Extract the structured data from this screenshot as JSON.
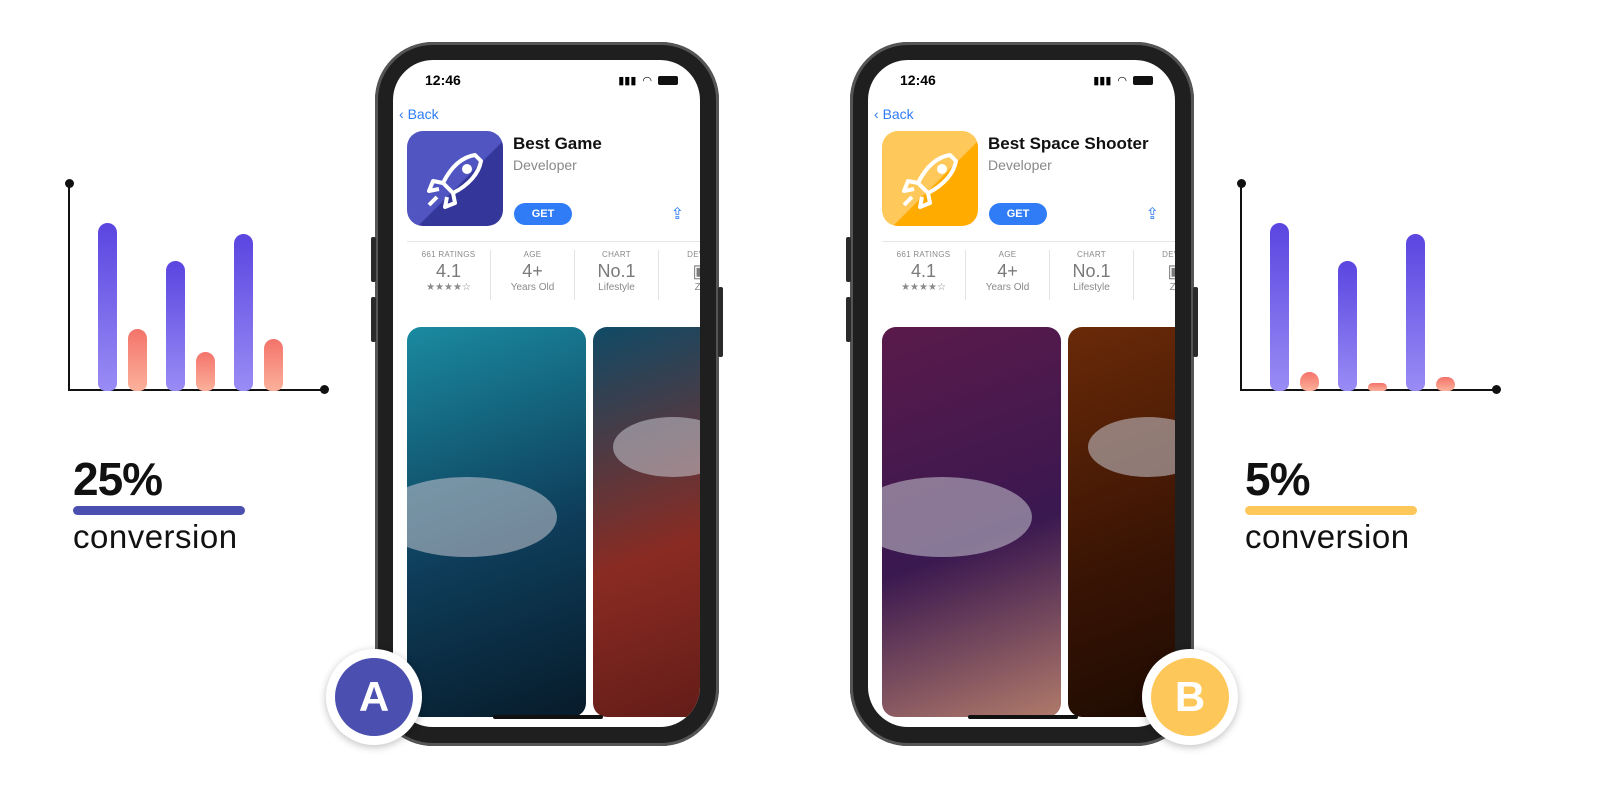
{
  "variants": [
    {
      "key": "a",
      "badge": "A",
      "accent": "#4b4fb0",
      "conversion_value": "25%",
      "conversion_label": "conversion",
      "chart_bars": [
        0.81,
        0.3,
        0.63,
        0.19,
        0.76,
        0.25
      ],
      "icon_colors": [
        "#5155c2",
        "#34369a"
      ],
      "app": {
        "time": "12:46",
        "back": "Back",
        "title": "Best Game",
        "developer": "Developer",
        "get": "GET",
        "stats": [
          {
            "h": "661 RATINGS",
            "v": "4.1",
            "s": "★★★★☆"
          },
          {
            "h": "AGE",
            "v": "4+",
            "s": "Years Old"
          },
          {
            "h": "CHART",
            "v": "No.1",
            "s": "Lifestyle"
          },
          {
            "h": "DEVEL",
            "v": "▣",
            "s": "ZA"
          }
        ]
      },
      "shots": [
        [
          "#1a8aa0",
          "#0e3d5a",
          "#071b2a"
        ],
        [
          "#0f4a66",
          "#8a2b22",
          "#5e1a17"
        ]
      ]
    },
    {
      "key": "b",
      "badge": "B",
      "accent": "#fdc75a",
      "conversion_value": "5%",
      "conversion_label": "conversion",
      "chart_bars": [
        0.81,
        0.09,
        0.63,
        0.04,
        0.76,
        0.07
      ],
      "icon_colors": [
        "#ffc85a",
        "#ffab00"
      ],
      "app": {
        "time": "12:46",
        "back": "Back",
        "title": "Best  Space Shooter",
        "developer": "Developer",
        "get": "GET",
        "stats": [
          {
            "h": "661 RATINGS",
            "v": "4.1",
            "s": "★★★★☆"
          },
          {
            "h": "AGE",
            "v": "4+",
            "s": "Years Old"
          },
          {
            "h": "CHART",
            "v": "No.1",
            "s": "Lifestyle"
          },
          {
            "h": "DEVEL",
            "v": "▣",
            "s": "ZA"
          }
        ]
      },
      "shots": [
        [
          "#5a1a4a",
          "#3a1850",
          "#b07a6a"
        ],
        [
          "#6a2a08",
          "#3a1404",
          "#1a0a02"
        ]
      ]
    }
  ]
}
